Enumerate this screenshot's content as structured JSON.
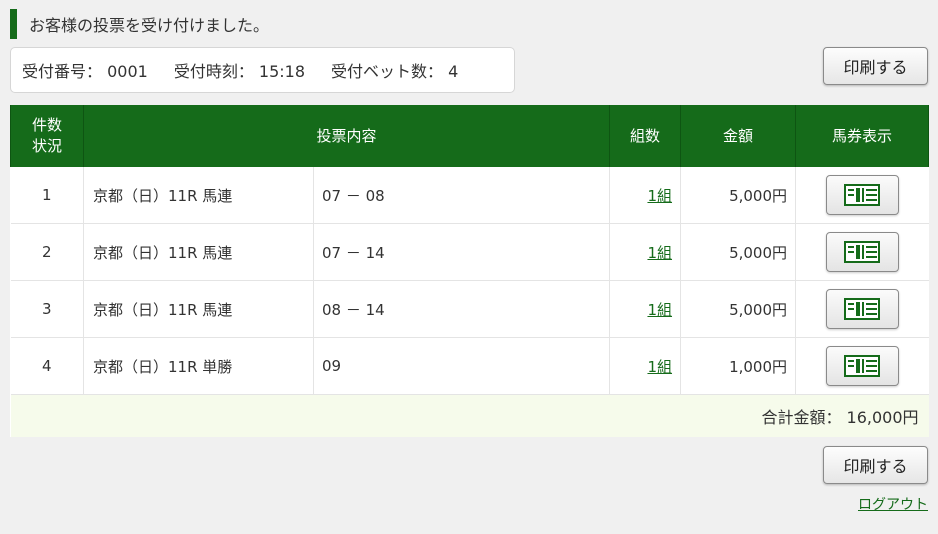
{
  "notice": {
    "message": "お客様の投票を受け付けました。"
  },
  "receipt": {
    "number": "受付番号： 0001",
    "time": "受付時刻： 15:18",
    "bet_count": "受付ベット数： 4"
  },
  "buttons": {
    "print_label": "印刷する"
  },
  "table": {
    "headers": {
      "count_line1": "件数",
      "count_line2": "状況",
      "content": "投票内容",
      "kumi": "組数",
      "amount": "金額",
      "ticket": "馬券表示"
    },
    "rows": [
      {
        "no": "1",
        "race": "京都（日）11R 馬連",
        "selection": "07 － 08",
        "kumi": "1組",
        "amount": "5,000円"
      },
      {
        "no": "2",
        "race": "京都（日）11R 馬連",
        "selection": "07 － 14",
        "kumi": "1組",
        "amount": "5,000円"
      },
      {
        "no": "3",
        "race": "京都（日）11R 馬連",
        "selection": "08 － 14",
        "kumi": "1組",
        "amount": "5,000円"
      },
      {
        "no": "4",
        "race": "京都（日）11R 単勝",
        "selection": "09",
        "kumi": "1組",
        "amount": "1,000円"
      }
    ],
    "total": "合計金額： 16,000円"
  },
  "footer": {
    "logout": "ログアウト"
  },
  "colors": {
    "accent": "#156b1a",
    "total_bg": "#f6fbeb"
  },
  "icons": {
    "ticket": "ticket-icon"
  }
}
